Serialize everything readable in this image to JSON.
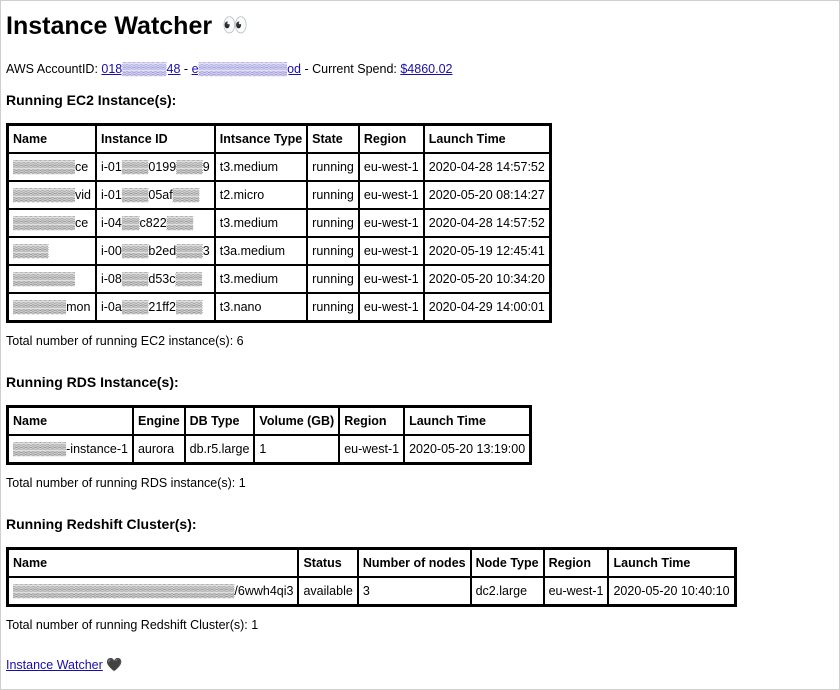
{
  "header": {
    "title": "Instance Watcher",
    "title_emoji": "👀"
  },
  "account": {
    "label": "AWS AccountID: ",
    "account_id": "018▒▒▒▒▒48",
    "separator1": " - ",
    "account_alias": "e▒▒▒▒▒▒▒▒▒▒od",
    "separator2": " - Current Spend: ",
    "spend": "$4860.02"
  },
  "ec2": {
    "heading": "Running EC2 Instance(s):",
    "columns": [
      "Name",
      "Instance ID",
      "Intsance Type",
      "State",
      "Region",
      "Launch Time"
    ],
    "rows": [
      [
        "▒▒▒▒▒▒▒ce",
        "i-01▒▒▒0199▒▒▒9",
        "t3.medium",
        "running",
        "eu-west-1",
        "2020-04-28 14:57:52"
      ],
      [
        "▒▒▒▒▒▒▒vid",
        "i-01▒▒▒05af▒▒▒",
        "t2.micro",
        "running",
        "eu-west-1",
        "2020-05-20 08:14:27"
      ],
      [
        "▒▒▒▒▒▒▒ce",
        "i-04▒▒c822▒▒▒",
        "t3.medium",
        "running",
        "eu-west-1",
        "2020-04-28 14:57:52"
      ],
      [
        "▒▒▒▒",
        "i-00▒▒▒b2ed▒▒▒3",
        "t3a.medium",
        "running",
        "eu-west-1",
        "2020-05-19 12:45:41"
      ],
      [
        "▒▒▒▒▒▒▒",
        "i-08▒▒▒d53c▒▒▒",
        "t3.medium",
        "running",
        "eu-west-1",
        "2020-05-20 10:34:20"
      ],
      [
        "▒▒▒▒▒▒mon",
        "i-0a▒▒▒21ff2▒▒▒",
        "t3.nano",
        "running",
        "eu-west-1",
        "2020-04-29 14:00:01"
      ]
    ],
    "total": "Total number of running EC2 instance(s): 6"
  },
  "rds": {
    "heading": "Running RDS Instance(s):",
    "columns": [
      "Name",
      "Engine",
      "DB Type",
      "Volume (GB)",
      "Region",
      "Launch Time"
    ],
    "rows": [
      [
        "▒▒▒▒▒▒-instance-1",
        "aurora",
        "db.r5.large",
        "1",
        "eu-west-1",
        "2020-05-20 13:19:00"
      ]
    ],
    "total": "Total number of running RDS instance(s): 1"
  },
  "redshift": {
    "heading": "Running Redshift Cluster(s):",
    "columns": [
      "Name",
      "Status",
      "Number of nodes",
      "Node Type",
      "Region",
      "Launch Time"
    ],
    "rows": [
      [
        "▒▒▒▒▒▒▒▒▒▒▒▒▒▒▒▒▒▒▒▒▒▒▒▒▒/6wwh4qi3",
        "available",
        "3",
        "dc2.large",
        "eu-west-1",
        "2020-05-20 10:40:10"
      ]
    ],
    "total": "Total number of running Redshift Cluster(s): 1"
  },
  "footer": {
    "link_text": "Instance Watcher",
    "heart": "🖤"
  }
}
